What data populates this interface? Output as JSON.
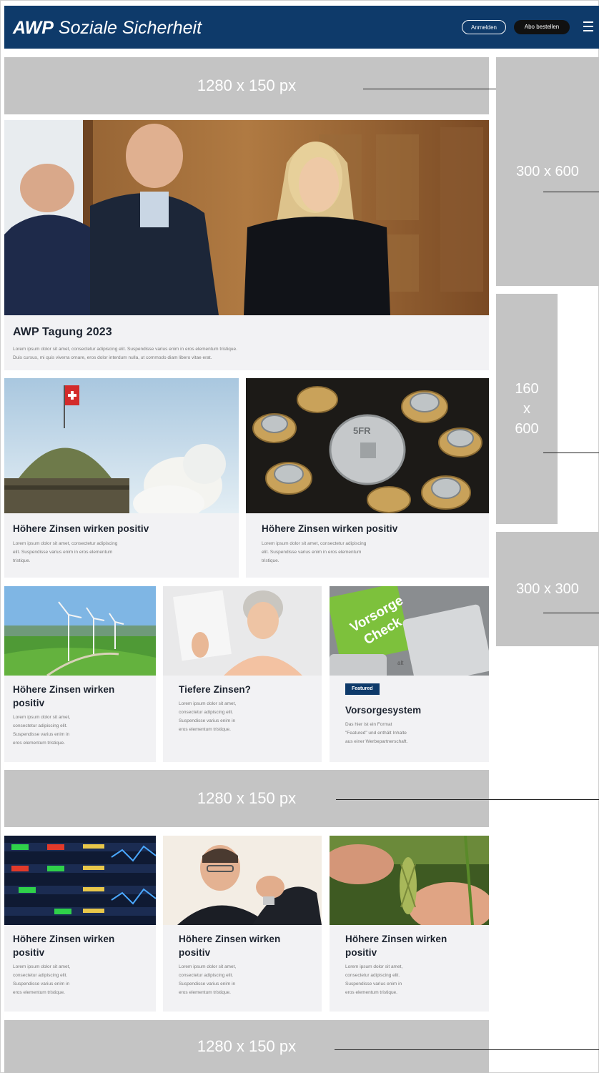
{
  "header": {
    "logo_bold": "AWP",
    "logo_rest": "Soziale Sicherheit",
    "login_label": "Anmelden",
    "abo_label": "Abo bestellen",
    "menu_icon": "hamburger-menu-icon",
    "colors": {
      "primary": "#0e3a6a",
      "ad_gray": "#c4c4c4",
      "card_bg": "#f2f2f4"
    }
  },
  "ads": {
    "leaderboard_top": "1280 x 150 px",
    "leaderboard_mid": "1280 x 150 px",
    "leaderboard_bottom": "1280 x 150 px",
    "halfpage": "300 x 600",
    "skyscraper_line1": "160",
    "skyscraper_line2": "x",
    "skyscraper_line3": "600",
    "square": "300 x 300"
  },
  "hero": {
    "title": "AWP Tagung 2023",
    "text_line1": "Lorem ipsum dolor sit amet, consectetur adipiscing elit. Suspendisse varius enim in eros elementum tristique.",
    "text_line2": "Duis cursus, mi quis viverra ornare, eros dolor interdum nulla, ut commodo diam libero vitae erat."
  },
  "row2": [
    {
      "title": "Höhere Zinsen wirken positiv",
      "text": [
        "Lorem ipsum dolor sit amet, consectetur adipiscing",
        "elit. Suspendisse varius enim in eros elementum",
        "tristique."
      ]
    },
    {
      "title": "Höhere Zinsen wirken positiv",
      "text": [
        "Lorem ipsum dolor sit amet, consectetur adipiscing",
        "elit. Suspendisse varius enim in eros elementum",
        "tristique."
      ]
    }
  ],
  "row3": [
    {
      "title": [
        "Höhere Zinsen wirken",
        "positiv"
      ],
      "text": [
        "Lorem ipsum dolor sit amet,",
        "consectetur adipiscing elit.",
        "Suspendisse varius enim in",
        "eros elementum tristique."
      ]
    },
    {
      "title": [
        "Tiefere Zinsen?"
      ],
      "text": [
        "Lorem ipsum dolor sit amet,",
        "consectetur adipiscing elit.",
        "Suspendisse varius enim in",
        "eros elementum tristique."
      ]
    },
    {
      "badge": "Featured",
      "image_text_line1": "Vorsorge",
      "image_text_line2": "Check",
      "image_key_text": "alt",
      "title": [
        "Vorsorgesystem"
      ],
      "text": [
        "Das hier ist ein Format",
        "\"Featured\" und enthält Inhalte",
        "aus einer Werbepartnerschaft."
      ]
    }
  ],
  "row4": [
    {
      "title": [
        "Höhere Zinsen wirken",
        "positiv"
      ],
      "text": [
        "Lorem ipsum dolor sit amet,",
        "consectetur adipiscing elit.",
        "Suspendisse varius enim in",
        "eros elementum tristique."
      ]
    },
    {
      "title": [
        "Höhere Zinsen wirken",
        "positiv"
      ],
      "text": [
        "Lorem ipsum dolor sit amet,",
        "consectetur adipiscing elit.",
        "Suspendisse varius enim in",
        "eros elementum tristique."
      ]
    },
    {
      "title": [
        "Höhere Zinsen wirken",
        "positiv"
      ],
      "text": [
        "Lorem ipsum dolor sit amet,",
        "consectetur adipiscing elit.",
        "Suspendisse varius enim in",
        "eros elementum tristique."
      ]
    }
  ]
}
